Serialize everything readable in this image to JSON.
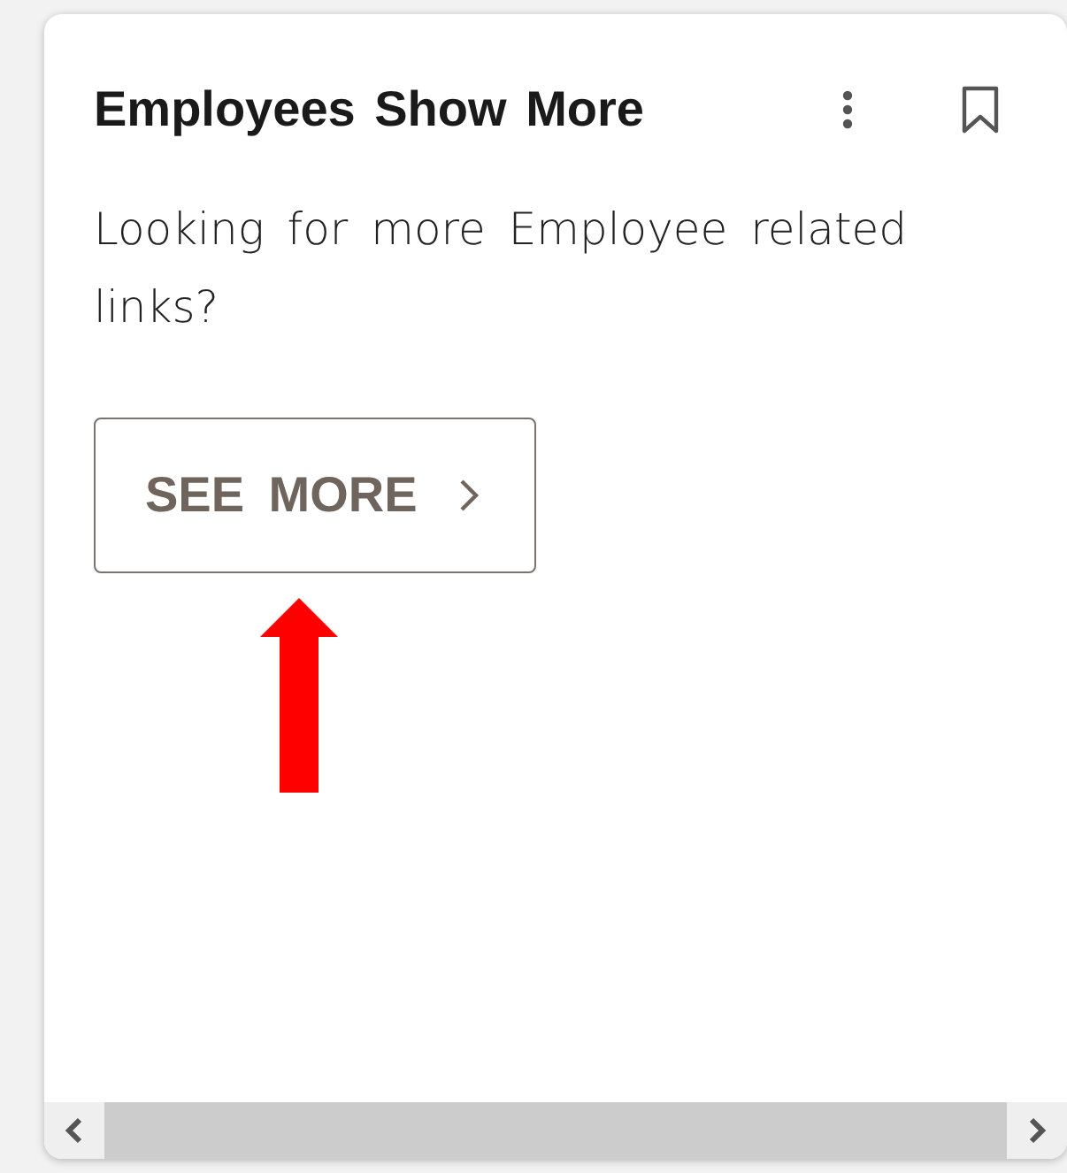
{
  "card": {
    "title": "Employees Show More",
    "description": "Looking for more Employee related links?",
    "button": {
      "label": "SEE MORE"
    }
  }
}
